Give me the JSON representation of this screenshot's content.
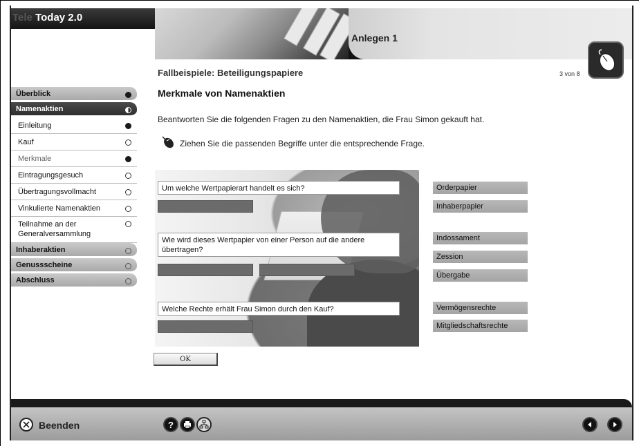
{
  "app": {
    "title": "Today 2.0",
    "title_prefix": "Tele"
  },
  "banner": {
    "title": "Anlegen 1"
  },
  "header": {
    "breadcrumb": "Fallbeispiele: Beteiligungspapiere",
    "page_count": "3 von 8"
  },
  "sidebar": {
    "sections": [
      {
        "label": "Überblick",
        "status": "filled"
      },
      {
        "label": "Namenaktien",
        "status": "half",
        "active": true
      }
    ],
    "items": [
      {
        "label": "Einleitung",
        "status": "filled"
      },
      {
        "label": "Kauf",
        "status": "empty"
      },
      {
        "label": "Merkmale",
        "status": "filled"
      },
      {
        "label": "Eintragungsgesuch",
        "status": "empty"
      },
      {
        "label": "Übertragungsvollmacht",
        "status": "empty"
      },
      {
        "label": "Vinkulierte Namenaktien",
        "status": "empty"
      },
      {
        "label": "Teilnahme an der Generalversammlung",
        "status": "empty"
      }
    ],
    "more_sections": [
      {
        "label": "Inhaberaktien",
        "status": "empty"
      },
      {
        "label": "Genussscheine",
        "status": "empty"
      },
      {
        "label": "Abschluss",
        "status": "empty"
      }
    ]
  },
  "main": {
    "title": "Merkmale von Namenaktien",
    "intro": "Beantworten Sie die folgenden Fragen zu den Namenaktien, die Frau Simon gekauft hat.",
    "instruction": "Ziehen Sie die passenden Begriffe unter die entsprechende Frage.",
    "questions": [
      "Um welche Wertpapierart handelt es sich?",
      "Wie wird dieses Wertpapier von einer Person auf die andere übertragen?",
      "Welche Rechte erhält Frau Simon durch den Kauf?"
    ],
    "terms": [
      "Orderpapier",
      "Inhaberpapier",
      "Indossament",
      "Zession",
      "Übergabe",
      "Vermögensrechte",
      "Mitgliedschaftsrechte"
    ],
    "ok_label": "OK"
  },
  "footer": {
    "quit_label": "Beenden",
    "icons": [
      "close-icon",
      "help-icon",
      "print-icon",
      "network-icon",
      "back-icon",
      "forward-icon"
    ]
  },
  "colors": {
    "active_section": "#2e2e2e",
    "term_bg": "#a9a9a9",
    "drop_zone": "#6b6b6b"
  }
}
